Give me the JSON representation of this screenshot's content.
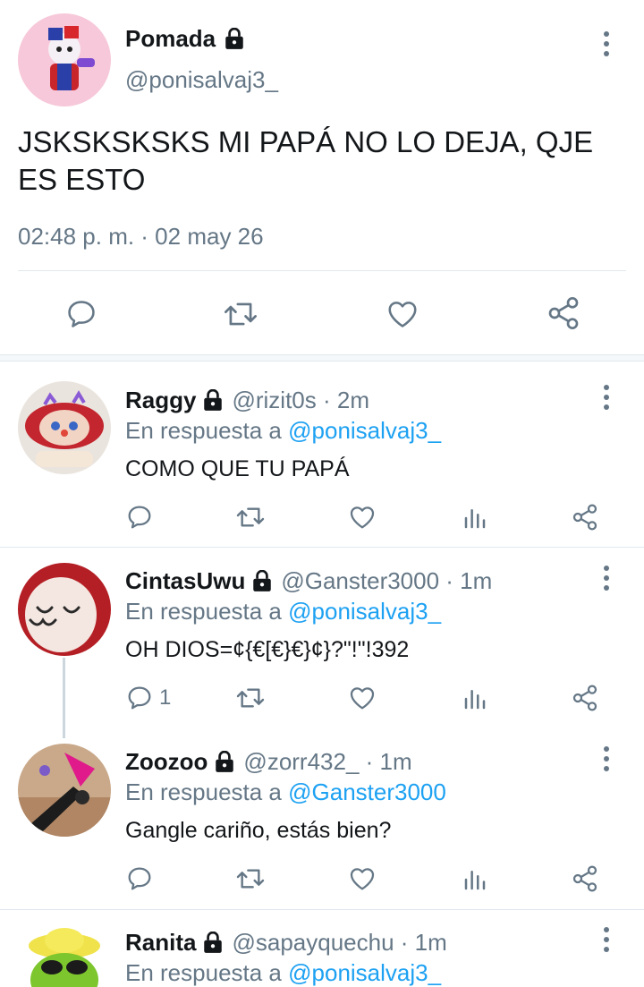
{
  "main_tweet": {
    "name": "Pomada",
    "handle": "@ponisalvaj3_",
    "text": "JSKSKSKSKS MI PAPÁ NO LO DEJA, QJE ES ESTO",
    "timestamp": "02:48 p. m. · 02 may 26"
  },
  "replies": [
    {
      "name": "Raggy",
      "handle": "@rizit0s · 2m",
      "reply_prefix": "En respuesta a ",
      "reply_to": "@ponisalvaj3_",
      "text": "COMO QUE TU PAPÁ",
      "reply_count": ""
    },
    {
      "name": "CintasUwu",
      "handle": "@Ganster3000 · 1m",
      "reply_prefix": "En respuesta a ",
      "reply_to": "@ponisalvaj3_",
      "text": "OH DIOS=¢{€[€}€}¢}?\"!\"!392",
      "reply_count": "1"
    },
    {
      "name": "Zoozoo",
      "handle": "@zorr432_ · 1m",
      "reply_prefix": "En respuesta a ",
      "reply_to": "@Ganster3000",
      "text": "Gangle cariño, estás bien?",
      "reply_count": ""
    },
    {
      "name": "Ranita",
      "handle": "@sapayquechu · 1m",
      "reply_prefix": "En respuesta a ",
      "reply_to": "@ponisalvaj3_",
      "text": "",
      "reply_count": ""
    }
  ],
  "icons": [
    "reply-icon",
    "retweet-icon",
    "like-icon",
    "analytics-icon",
    "share-icon",
    "lock-icon",
    "more-icon"
  ],
  "colors": {
    "accent": "#1da1f2",
    "secondary_text": "#657786",
    "divider": "#e1e8ed"
  }
}
